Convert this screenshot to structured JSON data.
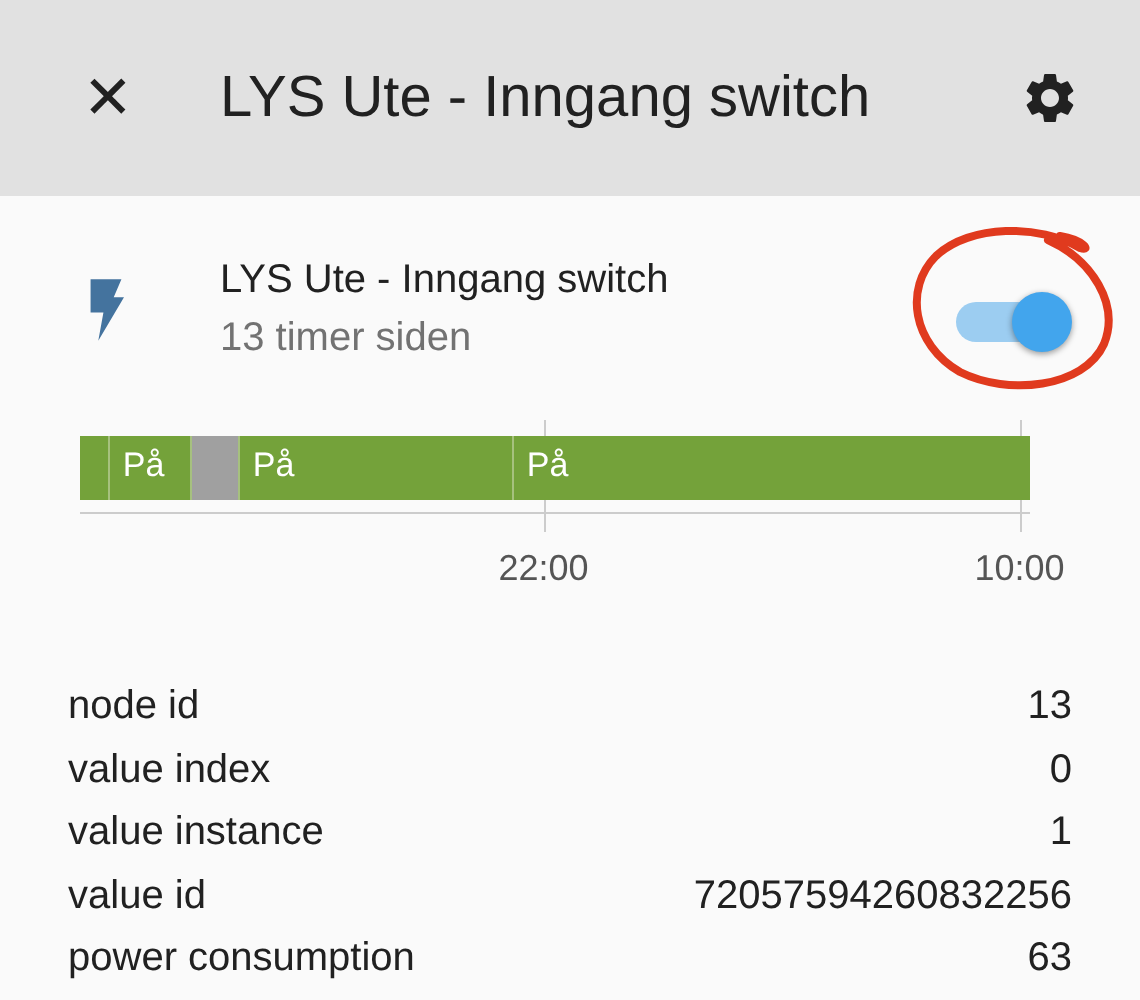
{
  "header": {
    "close": "✕",
    "title": "LYS Ute - Inngang switch"
  },
  "entity": {
    "name": "LYS Ute - Inngang switch",
    "last_changed": "13 timer siden",
    "on": true
  },
  "timeline": {
    "segments": [
      {
        "on": true
      },
      {
        "on": true,
        "label": "På"
      },
      {
        "on": false
      },
      {
        "on": true,
        "label": "På"
      },
      {
        "on": true,
        "label": "På"
      }
    ],
    "ticks": [
      "22:00",
      "10:00"
    ]
  },
  "attributes": [
    {
      "name": "node id",
      "value": "13"
    },
    {
      "name": "value index",
      "value": "0"
    },
    {
      "name": "value instance",
      "value": "1"
    },
    {
      "name": "value id",
      "value": "72057594260832256"
    },
    {
      "name": "power consumption",
      "value": "63"
    }
  ]
}
